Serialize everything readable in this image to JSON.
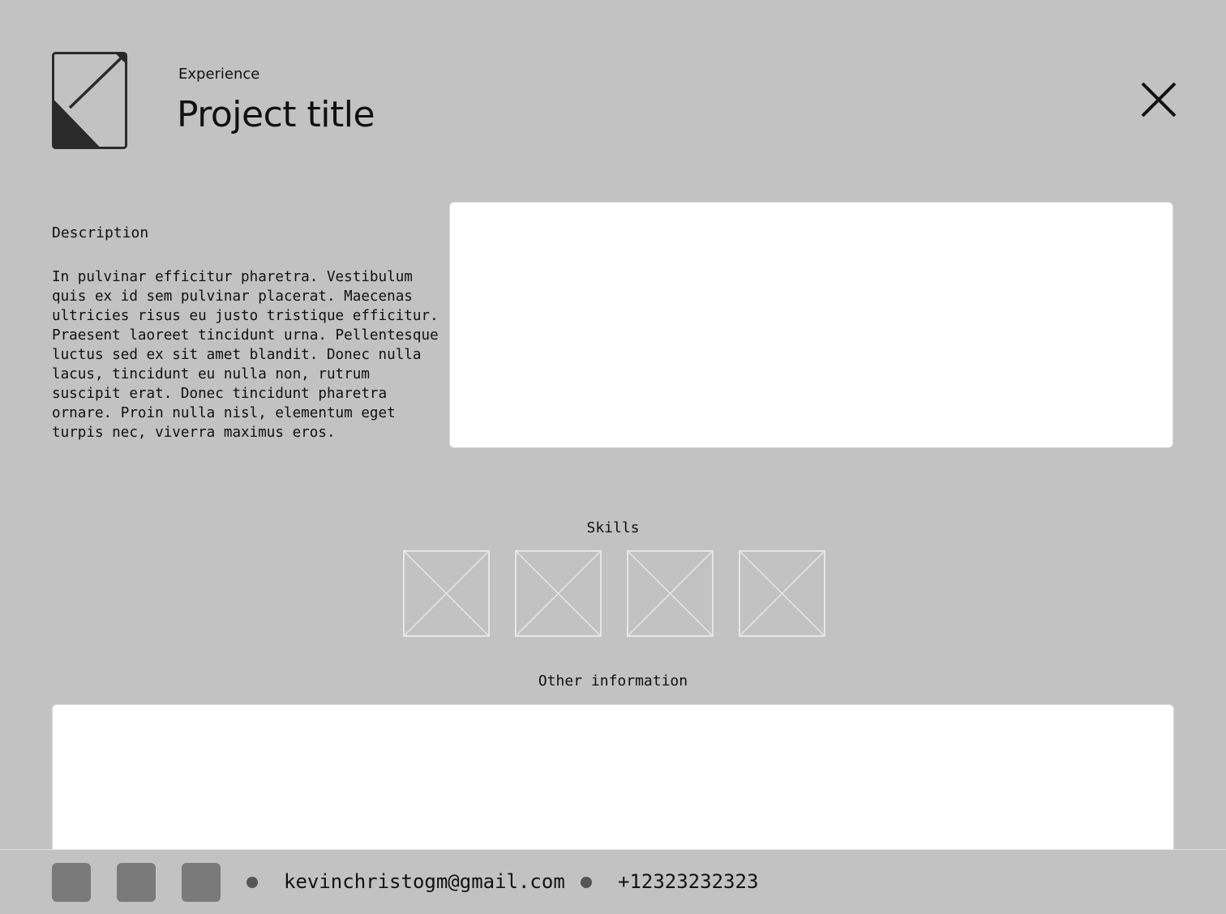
{
  "header": {
    "kicker": "Experience",
    "title": "Project title",
    "logo_icon": "diagonal-arrow-logo-icon",
    "close_icon": "close-icon"
  },
  "description": {
    "label": "Description",
    "text": "In pulvinar efficitur pharetra. Vestibulum quis ex id sem pulvinar placerat. Maecenas ultricies risus eu justo tristique efficitur. Praesent laoreet tincidunt urna. Pellentesque luctus sed ex sit amet blandit. Donec nulla lacus, tincidunt eu nulla non, rutrum suscipit erat. Donec tincidunt pharetra ornare. Proin nulla nisl, elementum eget turpis nec, viverra maximus eros."
  },
  "skills": {
    "label": "Skills",
    "item_icon": "image-placeholder-icon"
  },
  "other": {
    "label": "Other information"
  },
  "footer": {
    "email": "kevinchristogm@gmail.com",
    "phone": "+12323232323",
    "social_icon": "social-link-icon",
    "separator_icon": "dot-icon"
  },
  "colors": {
    "background": "#c2c2c2",
    "panel": "#ffffff",
    "text": "#111111",
    "social_icon_fill": "#7a7a7a",
    "separator_dot": "#555555",
    "placeholder_stroke": "#e6e6e6"
  }
}
